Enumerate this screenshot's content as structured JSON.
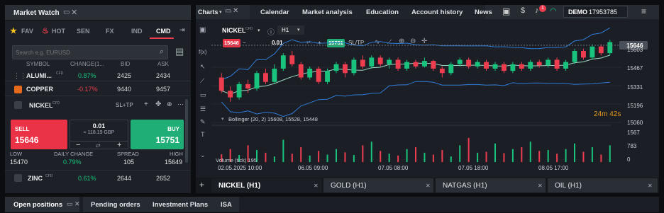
{
  "market_watch": {
    "title": "Market Watch",
    "tabs": [
      "FAV",
      "HOT",
      "SEN",
      "FX",
      "IND",
      "CMD"
    ],
    "active_tab": "CMD",
    "search_placeholder": "Search e.g. EURUSD",
    "columns": [
      "SYMBOL",
      "CHANGE(1...",
      "BID",
      "ASK"
    ],
    "rows": [
      {
        "symbol": "ALUMI...",
        "change": "0.87%",
        "bid": "2425",
        "ask": "2434",
        "dir": "up"
      },
      {
        "symbol": "COPPER",
        "change": "-0.17%",
        "bid": "9440",
        "ask": "9457",
        "dir": "down"
      }
    ],
    "selected": {
      "symbol": "NICKEL",
      "sltp": "SL+TP",
      "sell_label": "SELL",
      "sell_price": "15646",
      "buy_label": "BUY",
      "buy_price": "15751",
      "volume": "0.01",
      "margin": "≈ 118.19 GBP",
      "stats_labels": [
        "LOW",
        "DAILY CHANGE",
        "SPREAD",
        "HIGH"
      ],
      "stats_values": [
        "15470",
        "0.79%",
        "105",
        "15649"
      ]
    },
    "zinc": {
      "symbol": "ZINC",
      "change": "0.61%",
      "bid": "2644",
      "ask": "2652"
    },
    "cfd": "CFD"
  },
  "toolbar": {
    "charts_label": "Charts",
    "nav": [
      "Calendar",
      "Market analysis",
      "Education",
      "Account history",
      "News"
    ],
    "notification_count": "1",
    "account_mode": "DEMO",
    "account_number": "17953785"
  },
  "chart": {
    "symbol": "NICKEL",
    "timeframe": "H1",
    "order_sell": "15646",
    "order_volume": "0.01",
    "order_buy": "15751",
    "sltp": "SL/TP",
    "current_price": "15646",
    "countdown": "24m 42s",
    "bollinger_label": "Bollinger (20, 2) 15608, 15528, 15448",
    "volume_label": "Volume (tick) 195",
    "y_ticks": [
      "15603",
      "15467",
      "15331",
      "15196",
      "15060"
    ],
    "volume_ticks": [
      "1567",
      "783",
      "0"
    ],
    "x_ticks": [
      "02.05.2025 10:00",
      "06.05 09:00",
      "07.05 08:00",
      "07.05 18:00",
      "08.05 17:00"
    ],
    "candles": [
      [
        15500,
        15440,
        15520,
        15430
      ],
      [
        15440,
        15410,
        15460,
        15390
      ],
      [
        15410,
        15470,
        15480,
        15400
      ],
      [
        15470,
        15450,
        15490,
        15430
      ],
      [
        15450,
        15520,
        15530,
        15440
      ],
      [
        15520,
        15480,
        15540,
        15470
      ],
      [
        15480,
        15540,
        15560,
        15470
      ],
      [
        15540,
        15600,
        15610,
        15530
      ],
      [
        15600,
        15560,
        15620,
        15550
      ],
      [
        15560,
        15500,
        15570,
        15490
      ],
      [
        15500,
        15540,
        15550,
        15490
      ],
      [
        15540,
        15480,
        15550,
        15470
      ],
      [
        15480,
        15530,
        15540,
        15470
      ],
      [
        15530,
        15560,
        15570,
        15520
      ],
      [
        15560,
        15520,
        15570,
        15500
      ],
      [
        15520,
        15580,
        15590,
        15510
      ],
      [
        15580,
        15550,
        15600,
        15540
      ],
      [
        15550,
        15590,
        15600,
        15540
      ],
      [
        15590,
        15560,
        15600,
        15550
      ],
      [
        15560,
        15580,
        15590,
        15540
      ],
      [
        15580,
        15540,
        15590,
        15530
      ],
      [
        15540,
        15570,
        15580,
        15530
      ],
      [
        15570,
        15550,
        15580,
        15540
      ],
      [
        15550,
        15575,
        15590,
        15545
      ],
      [
        15575,
        15540,
        15580,
        15530
      ],
      [
        15540,
        15520,
        15550,
        15500
      ],
      [
        15520,
        15560,
        15570,
        15510
      ],
      [
        15560,
        15580,
        15590,
        15550
      ],
      [
        15580,
        15550,
        15590,
        15540
      ],
      [
        15550,
        15570,
        15580,
        15540
      ],
      [
        15570,
        15540,
        15580,
        15530
      ],
      [
        15540,
        15560,
        15570,
        15530
      ],
      [
        15560,
        15530,
        15570,
        15520
      ],
      [
        15530,
        15560,
        15570,
        15520
      ],
      [
        15560,
        15540,
        15570,
        15530
      ],
      [
        15540,
        15570,
        15580,
        15530
      ],
      [
        15570,
        15555,
        15580,
        15545
      ],
      [
        15555,
        15580,
        15590,
        15545
      ],
      [
        15580,
        15540,
        15590,
        15530
      ],
      [
        15540,
        15570,
        15580,
        15530
      ],
      [
        15570,
        15620,
        15630,
        15560
      ],
      [
        15620,
        15590,
        15630,
        15580
      ],
      [
        15590,
        15640,
        15650,
        15580
      ],
      [
        15640,
        15610,
        15650,
        15600
      ],
      [
        15610,
        15660,
        15670,
        15600
      ]
    ],
    "volumes": [
      420,
      700,
      380,
      900,
      650,
      500,
      300,
      1200,
      450,
      800,
      350,
      600,
      400,
      700,
      520,
      380,
      900,
      1100,
      600,
      450,
      350,
      700,
      800,
      500,
      400,
      650,
      300,
      900,
      1300,
      500,
      550,
      1000,
      480,
      700,
      800,
      1100,
      600,
      650,
      450,
      700,
      1000,
      550,
      800,
      400,
      900
    ],
    "bottom_tabs": [
      "NICKEL (H1)",
      "GOLD (H1)",
      "NATGAS (H1)",
      "OIL (H1)"
    ]
  },
  "bottom_bar": {
    "tabs": [
      "Open positions",
      "Pending orders",
      "Investment Plans",
      "ISA"
    ]
  },
  "colors": {
    "up": "#19c37d",
    "down": "#ef3d50",
    "accent": "#ef3d50",
    "buy": "#1fae76"
  }
}
